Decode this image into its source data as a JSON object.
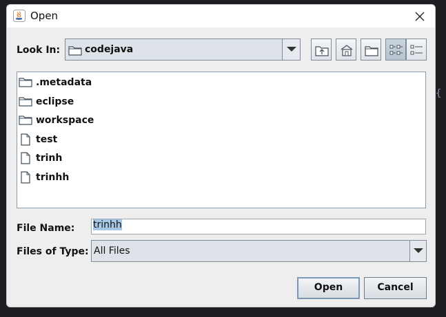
{
  "window": {
    "title": "Open"
  },
  "look_in": {
    "label": "Look In:",
    "value": "codejava"
  },
  "toolbar": {
    "buttons": [
      {
        "name": "up-one-level-icon"
      },
      {
        "name": "home-icon"
      },
      {
        "name": "new-folder-icon"
      },
      {
        "name": "list-view-icon",
        "active": true
      },
      {
        "name": "details-view-icon"
      }
    ]
  },
  "files": [
    {
      "name": ".metadata",
      "type": "folder"
    },
    {
      "name": "eclipse",
      "type": "folder"
    },
    {
      "name": "workspace",
      "type": "folder"
    },
    {
      "name": "test",
      "type": "file"
    },
    {
      "name": "trinh",
      "type": "file"
    },
    {
      "name": "trinhh",
      "type": "file"
    }
  ],
  "file_name": {
    "label": "File Name:",
    "value": "trinhh"
  },
  "files_of_type": {
    "label": "Files of Type:",
    "value": "All Files"
  },
  "buttons": {
    "open": "Open",
    "cancel": "Cancel"
  },
  "colors": {
    "dialog_bg": "#eeeeee",
    "selection": "#a7c7e6",
    "border": "#7f8b96"
  }
}
